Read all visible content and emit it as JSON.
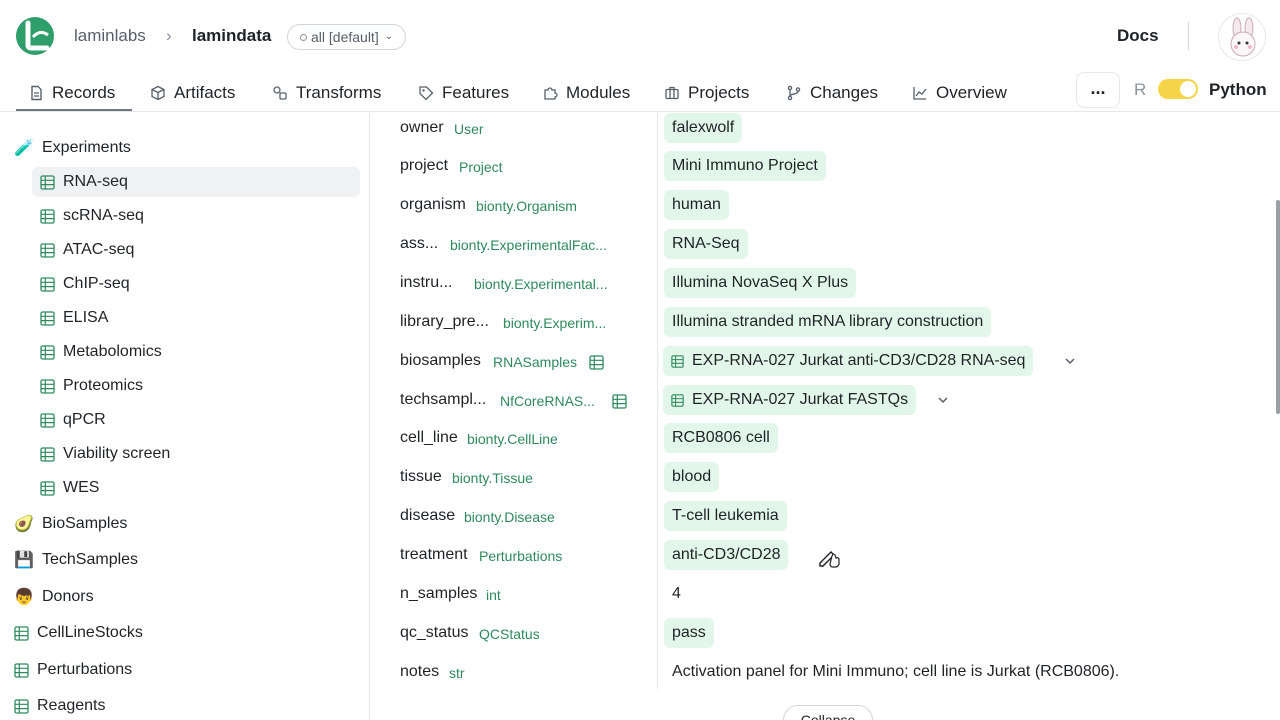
{
  "header": {
    "org": "laminlabs",
    "instance": "lamindata",
    "branch": "all [default]",
    "docs": "Docs"
  },
  "tabs": [
    {
      "label": "Records",
      "icon": "document-icon",
      "active": true
    },
    {
      "label": "Artifacts",
      "icon": "cube-icon"
    },
    {
      "label": "Transforms",
      "icon": "transform-icon"
    },
    {
      "label": "Features",
      "icon": "tag-icon"
    },
    {
      "label": "Modules",
      "icon": "puzzle-icon"
    },
    {
      "label": "Projects",
      "icon": "briefcase-icon"
    },
    {
      "label": "Changes",
      "icon": "git-branch-icon"
    },
    {
      "label": "Overview",
      "icon": "line-chart-icon"
    }
  ],
  "toolbar": {
    "more": "...",
    "lang_r": "R",
    "lang_python": "Python"
  },
  "sidebar": {
    "experiments": {
      "label": "Experiments",
      "emoji": "🧪"
    },
    "children": [
      {
        "label": "RNA-seq",
        "selected": true
      },
      {
        "label": "scRNA-seq"
      },
      {
        "label": "ATAC-seq"
      },
      {
        "label": "ChIP-seq"
      },
      {
        "label": "ELISA"
      },
      {
        "label": "Metabolomics"
      },
      {
        "label": "Proteomics"
      },
      {
        "label": "qPCR"
      },
      {
        "label": "Viability screen"
      },
      {
        "label": "WES"
      }
    ],
    "others": [
      {
        "label": "BioSamples",
        "emoji": "🥑"
      },
      {
        "label": "TechSamples",
        "emoji": "💾"
      },
      {
        "label": "Donors",
        "emoji": "👦"
      },
      {
        "label": "CellLineStocks",
        "icon": "grid"
      },
      {
        "label": "Perturbations",
        "icon": "grid"
      },
      {
        "label": "Reagents",
        "icon": "grid"
      }
    ]
  },
  "fields": [
    {
      "name": "owner",
      "type": "User",
      "value": "falexwolf"
    },
    {
      "name": "project",
      "type": "Project",
      "value": "Mini Immuno Project"
    },
    {
      "name": "organism",
      "type": "bionty.Organism",
      "value": "human"
    },
    {
      "name": "ass...",
      "type": "bionty.ExperimentalFac...",
      "value": "RNA-Seq"
    },
    {
      "name": "instru...",
      "type": "bionty.Experimental...",
      "value": "Illumina NovaSeq X Plus"
    },
    {
      "name": "library_pre...",
      "type": "bionty.Experim...",
      "value": "Illumina stranded mRNA library construction"
    },
    {
      "name": "biosamples",
      "type": "RNASamples",
      "value": "EXP-RNA-027 Jurkat anti-CD3/CD28 RNA-seq"
    },
    {
      "name": "techsampl...",
      "type": "NfCoreRNAS...",
      "value": "EXP-RNA-027 Jurkat FASTQs"
    },
    {
      "name": "cell_line",
      "type": "bionty.CellLine",
      "value": "RCB0806 cell"
    },
    {
      "name": "tissue",
      "type": "bionty.Tissue",
      "value": "blood"
    },
    {
      "name": "disease",
      "type": "bionty.Disease",
      "value": "T-cell leukemia"
    },
    {
      "name": "treatment",
      "type": "Perturbations",
      "value": "anti-CD3/CD28"
    },
    {
      "name": "n_samples",
      "type": "int",
      "value": "4"
    },
    {
      "name": "qc_status",
      "type": "QCStatus",
      "value": "pass"
    },
    {
      "name": "notes",
      "type": "str",
      "value": "Activation panel for Mini Immuno; cell line is Jurkat (RCB0806)."
    }
  ],
  "collapse_label": "Collapse",
  "colors": {
    "chip_bg": "#e3f6ea",
    "type_text": "#2e8a5c",
    "toggle": "#f5d547"
  }
}
